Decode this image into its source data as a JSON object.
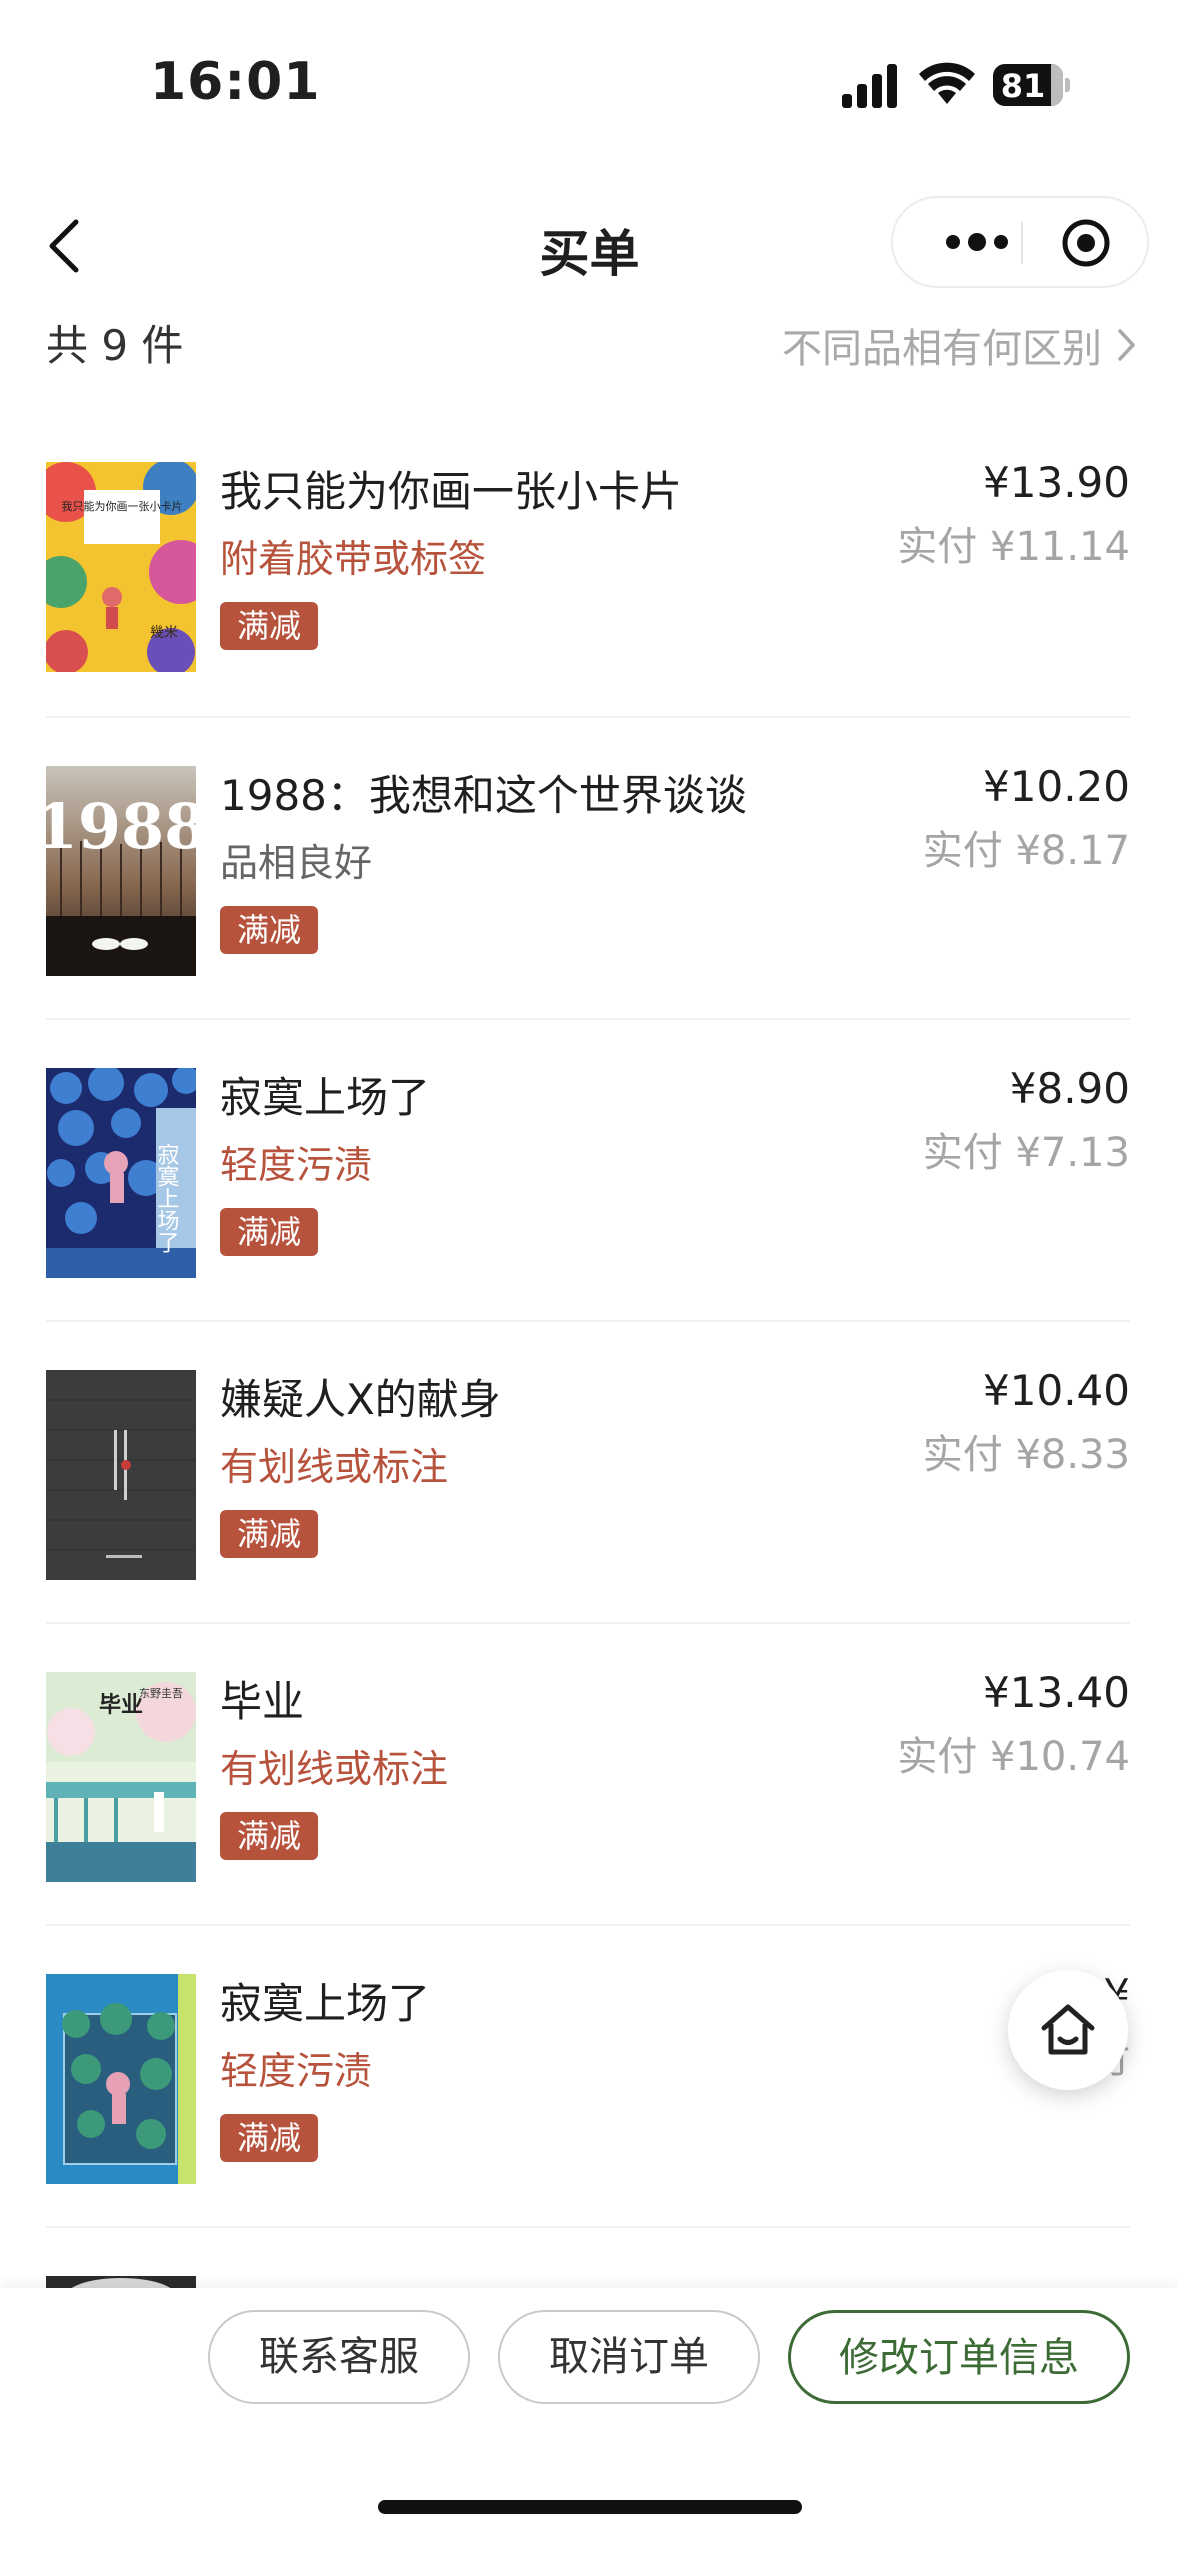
{
  "status_bar": {
    "time": "16:01",
    "battery": "81"
  },
  "nav": {
    "title": "买单"
  },
  "summary": {
    "count_text": "共 9 件",
    "diff_link": "不同品相有何区别"
  },
  "colors": {
    "condition_red": "#b7533d",
    "condition_grey": "#666666",
    "badge": "#b7533d",
    "accent_green": "#3c6b35"
  },
  "items": [
    {
      "name": "我只能为你画一张小卡片",
      "condition": "附着胶带或标签",
      "condition_color": "#b7533d",
      "badge": "满减",
      "price": "¥13.90",
      "paid": "实付 ¥11.14",
      "cover_title": "我只能为你画一张小卡片",
      "cover_author": "幾米"
    },
    {
      "name": "1988：我想和这个世界谈谈",
      "condition": "品相良好",
      "condition_color": "#666666",
      "badge": "满减",
      "price": "¥10.20",
      "paid": "实付 ¥8.17",
      "cover_title": "1988"
    },
    {
      "name": "寂寞上场了",
      "condition": "轻度污渍",
      "condition_color": "#b7533d",
      "badge": "满减",
      "price": "¥8.90",
      "paid": "实付 ¥7.13",
      "cover_title": "寂寞上场了"
    },
    {
      "name": "嫌疑人X的献身",
      "condition": "有划线或标注",
      "condition_color": "#b7533d",
      "badge": "满减",
      "price": "¥10.40",
      "paid": "实付 ¥8.33"
    },
    {
      "name": "毕业",
      "condition": "有划线或标注",
      "condition_color": "#b7533d",
      "badge": "满减",
      "price": "¥13.40",
      "paid": "实付 ¥10.74",
      "cover_title": "毕业",
      "cover_author": "东野圭吾"
    },
    {
      "name": "寂寞上场了",
      "condition": "轻度污渍",
      "condition_color": "#b7533d",
      "badge": "满减",
      "price": "¥",
      "paid": "实付"
    }
  ],
  "bottom_bar": {
    "contact": "联系客服",
    "cancel": "取消订单",
    "modify": "修改订单信息"
  }
}
